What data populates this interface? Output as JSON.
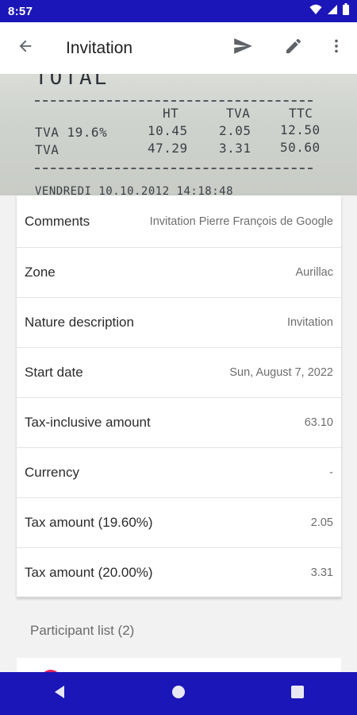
{
  "status_bar": {
    "time": "8:57",
    "icons": [
      "wifi-icon",
      "signal-icon",
      "battery-icon"
    ]
  },
  "app_bar": {
    "title": "Invitation",
    "actions": [
      "send-icon",
      "edit-icon",
      "more-vert-icon"
    ]
  },
  "receipt": {
    "header_partial": "TOTAL",
    "columns": [
      "HT",
      "TVA",
      "TTC"
    ],
    "rows": [
      {
        "label": "TVA 19.6%",
        "ht": "10.45",
        "tva": "2.05",
        "ttc": "12.50"
      },
      {
        "label": "TVA",
        "ht": "47.29",
        "tva": "3.31",
        "ttc": "50.60"
      }
    ],
    "footer_partial": "VENDREDI 10.10.2012 14:18:48"
  },
  "details": [
    {
      "label": "Comments",
      "value": "Invitation Pierre François de Google"
    },
    {
      "label": "Zone",
      "value": "Aurillac"
    },
    {
      "label": "Nature description",
      "value": "Invitation"
    },
    {
      "label": "Start date",
      "value": "Sun, August 7, 2022"
    },
    {
      "label": "Tax-inclusive amount",
      "value": "63.10"
    },
    {
      "label": "Currency",
      "value": "-"
    },
    {
      "label": "Tax amount (19.60%)",
      "value": "2.05"
    },
    {
      "label": "Tax amount (20.00%)",
      "value": "3.31"
    }
  ],
  "participants": {
    "header": "Participant list (2)"
  },
  "colors": {
    "system_bar": "#1a16b8",
    "avatar": "#e0245e"
  }
}
